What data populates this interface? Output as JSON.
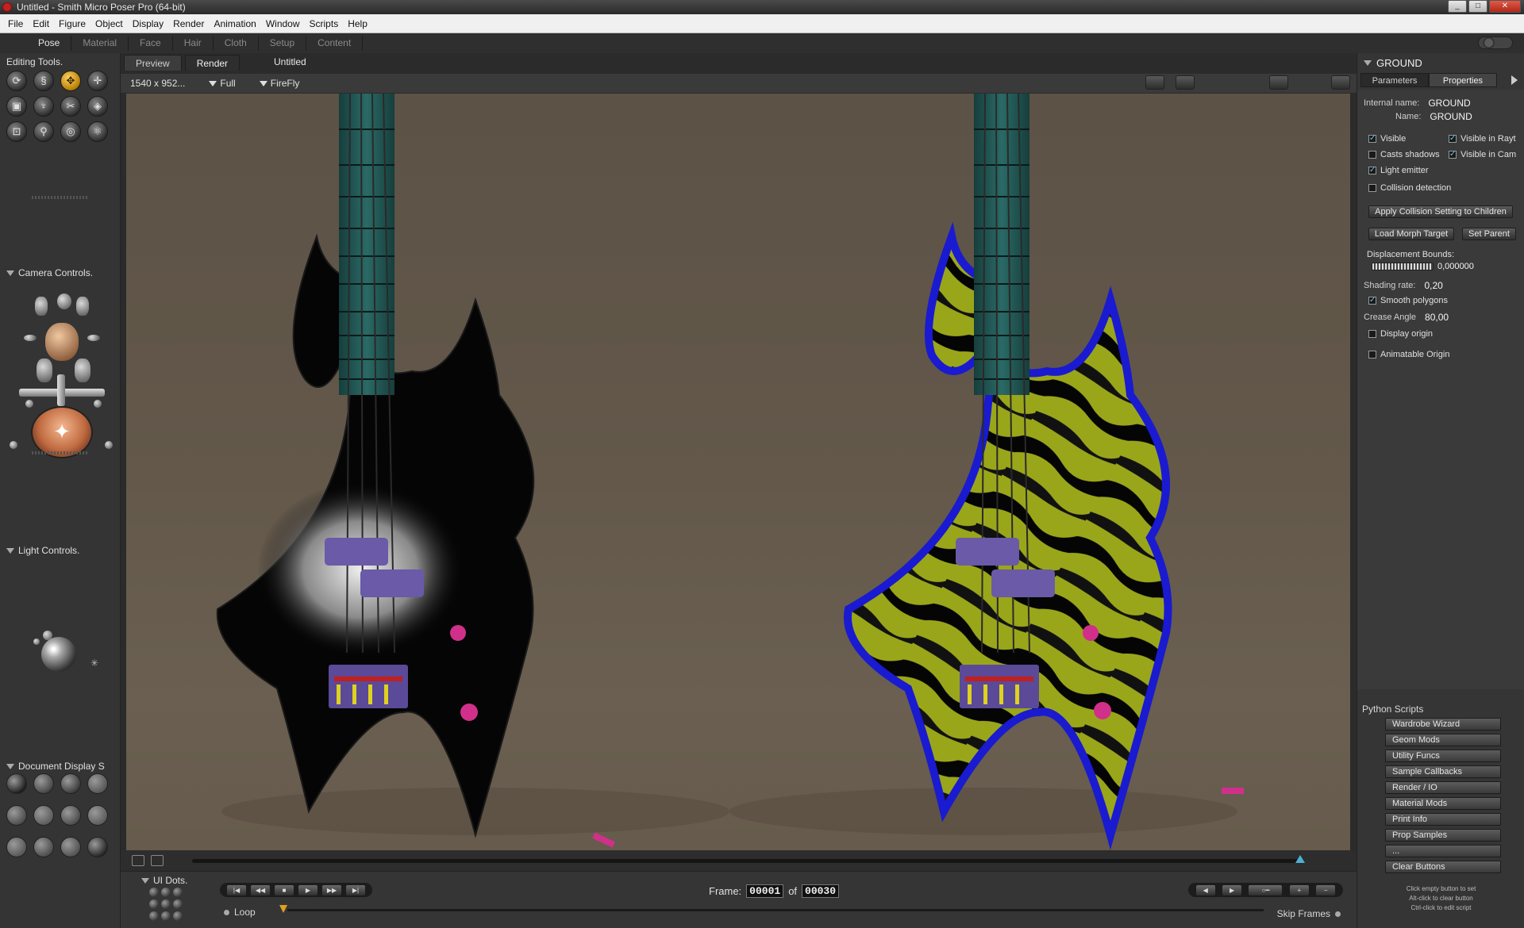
{
  "window": {
    "title": "Untitled - Smith Micro Poser Pro  (64-bit)",
    "controls": [
      "_",
      "□",
      "✕"
    ]
  },
  "menu": [
    "File",
    "Edit",
    "Figure",
    "Object",
    "Display",
    "Render",
    "Animation",
    "Window",
    "Scripts",
    "Help"
  ],
  "rooms": [
    "Pose",
    "Material",
    "Face",
    "Hair",
    "Cloth",
    "Setup",
    "Content"
  ],
  "left": {
    "editing_tools": "Editing Tools.",
    "camera_controls": "Camera Controls.",
    "light_controls": "Light Controls.",
    "document_display": "Document Display S",
    "doc_styles": [
      {
        "name": "silhouette-style-icon",
        "color": "#1a1a1a"
      },
      {
        "name": "outline-style-icon",
        "color": "#444444"
      },
      {
        "name": "wireframe-style-icon",
        "color": "#3a3a3a"
      },
      {
        "name": "hidden-line-style-icon",
        "color": "#555555"
      },
      {
        "name": "lit-wireframe-style-icon",
        "color": "#4a4a4a"
      },
      {
        "name": "flat-shaded-style-icon",
        "color": "#5a5a5a"
      },
      {
        "name": "flat-lined-style-icon",
        "color": "#4a4a4a"
      },
      {
        "name": "cartoon-style-icon",
        "color": "#5a5a5a"
      },
      {
        "name": "cartoon-lined-style-icon",
        "color": "#555555"
      },
      {
        "name": "smooth-shaded-style-icon",
        "color": "#4a4a4a"
      },
      {
        "name": "smooth-lined-style-icon",
        "color": "#4f4f4f"
      },
      {
        "name": "texture-shaded-style-icon",
        "color": "#222222"
      }
    ]
  },
  "document": {
    "tabs": [
      "Preview",
      "Render"
    ],
    "active_tab": "Render",
    "name": "Untitled",
    "size": "1540 x 952...",
    "view_mode": "Full",
    "renderer": "FireFly"
  },
  "animation": {
    "ui_dots": "UI Dots.",
    "loop_label": "Loop",
    "frame_label": "Frame:",
    "frame_current": "00001",
    "of_label": "of",
    "frame_total": "00030",
    "skip_frames": "Skip Frames"
  },
  "properties": {
    "title": "GROUND",
    "tabs": [
      "Parameters",
      "Properties"
    ],
    "active_tab": "Properties",
    "internal_name_label": "Internal name:",
    "internal_name": "GROUND",
    "name_label": "Name:",
    "name": "GROUND",
    "visible": "Visible",
    "visible_raytrace": "Visible in Rayt",
    "casts_shadows": "Casts shadows",
    "visible_camera": "Visible in Cam",
    "light_emitter": "Light emitter",
    "collision_detection": "Collision detection",
    "apply_collision": "Apply Collision Setting to Children",
    "load_morph": "Load Morph Target",
    "set_parent": "Set Parent",
    "displacement_label": "Displacement Bounds:",
    "displacement_value": "0,000000",
    "shading_rate_label": "Shading rate:",
    "shading_rate": "0,20",
    "smooth_polygons": "Smooth polygons",
    "crease_angle_label": "Crease Angle",
    "crease_angle": "80,00",
    "display_origin": "Display origin",
    "animatable_origin": "Animatable Origin",
    "checks": {
      "visible": true,
      "visible_raytrace": true,
      "casts_shadows": false,
      "visible_camera": true,
      "light_emitter": true,
      "collision_detection": false,
      "smooth_polygons": true,
      "display_origin": false,
      "animatable_origin": false
    }
  },
  "python": {
    "title": "Python Scripts",
    "buttons": [
      "Wardrobe Wizard",
      "Geom Mods",
      "Utility Funcs",
      "Sample Callbacks",
      "Render / IO",
      "Material Mods",
      "Print Info",
      "Prop Samples",
      "...",
      "Clear Buttons"
    ],
    "hints": [
      "Click empty button to set",
      "Alt-click to clear button",
      "Ctrl-click to edit script"
    ]
  },
  "colors": {
    "guitar_left_body": "#050505",
    "guitar_right_stripe": "#9aa61a",
    "guitar_right_edge": "#1a1ad0",
    "neck": "#1f5a58",
    "pickup": "#6a5aa8",
    "knob": "#d0308a"
  }
}
